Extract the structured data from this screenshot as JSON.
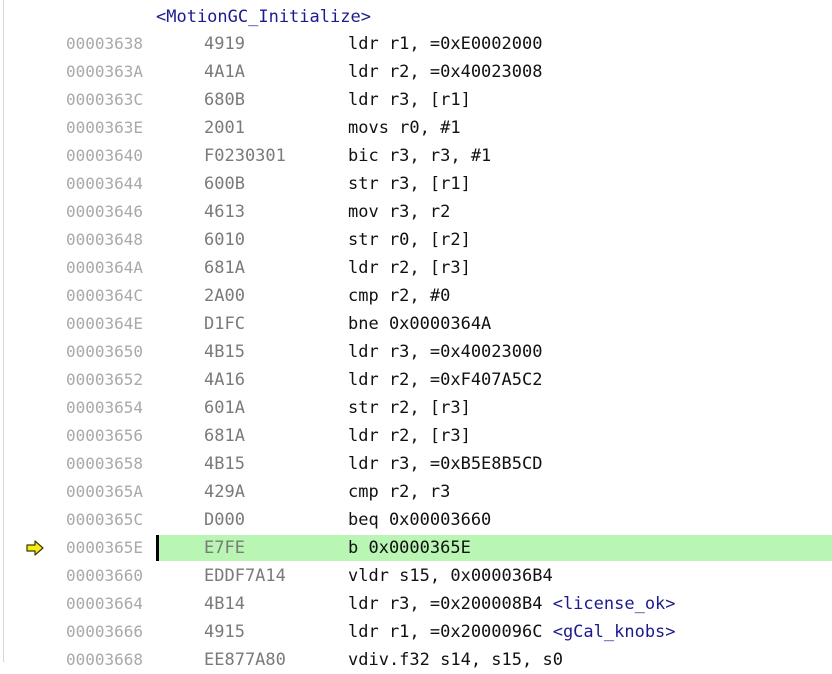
{
  "window": {
    "title": ""
  },
  "disassembly": {
    "symbol": "<MotionGC_Initialize>",
    "current_index": 18,
    "colors": {
      "current_line_bg": "#b9f5b3",
      "address": "#a9a9a9",
      "opcode": "#7a7a7a",
      "symbol": "#1b1b8f",
      "arrow": "#f5ea1a"
    },
    "pc_icon": "execution-arrow-icon",
    "rows": [
      {
        "addr": "00003638",
        "opcode": "4919",
        "instr": "ldr r1, =0xE0002000",
        "annot": ""
      },
      {
        "addr": "0000363A",
        "opcode": "4A1A",
        "instr": "ldr r2, =0x40023008",
        "annot": ""
      },
      {
        "addr": "0000363C",
        "opcode": "680B",
        "instr": "ldr r3, [r1]",
        "annot": ""
      },
      {
        "addr": "0000363E",
        "opcode": "2001",
        "instr": "movs r0, #1",
        "annot": ""
      },
      {
        "addr": "00003640",
        "opcode": "F0230301",
        "instr": "bic r3, r3, #1",
        "annot": ""
      },
      {
        "addr": "00003644",
        "opcode": "600B",
        "instr": "str r3, [r1]",
        "annot": ""
      },
      {
        "addr": "00003646",
        "opcode": "4613",
        "instr": "mov r3, r2",
        "annot": ""
      },
      {
        "addr": "00003648",
        "opcode": "6010",
        "instr": "str r0, [r2]",
        "annot": ""
      },
      {
        "addr": "0000364A",
        "opcode": "681A",
        "instr": "ldr r2, [r3]",
        "annot": ""
      },
      {
        "addr": "0000364C",
        "opcode": "2A00",
        "instr": "cmp r2, #0",
        "annot": ""
      },
      {
        "addr": "0000364E",
        "opcode": "D1FC",
        "instr": "bne 0x0000364A",
        "annot": ""
      },
      {
        "addr": "00003650",
        "opcode": "4B15",
        "instr": "ldr r3, =0x40023000",
        "annot": ""
      },
      {
        "addr": "00003652",
        "opcode": "4A16",
        "instr": "ldr r2, =0xF407A5C2",
        "annot": ""
      },
      {
        "addr": "00003654",
        "opcode": "601A",
        "instr": "str r2, [r3]",
        "annot": ""
      },
      {
        "addr": "00003656",
        "opcode": "681A",
        "instr": "ldr r2, [r3]",
        "annot": ""
      },
      {
        "addr": "00003658",
        "opcode": "4B15",
        "instr": "ldr r3, =0xB5E8B5CD",
        "annot": ""
      },
      {
        "addr": "0000365A",
        "opcode": "429A",
        "instr": "cmp r2, r3",
        "annot": ""
      },
      {
        "addr": "0000365C",
        "opcode": "D000",
        "instr": "beq 0x00003660",
        "annot": ""
      },
      {
        "addr": "0000365E",
        "opcode": "E7FE",
        "instr": "b 0x0000365E",
        "annot": ""
      },
      {
        "addr": "00003660",
        "opcode": "EDDF7A14",
        "instr": "vldr s15, 0x000036B4",
        "annot": ""
      },
      {
        "addr": "00003664",
        "opcode": "4B14",
        "instr": "ldr r3, =0x200008B4 ",
        "annot": "<license_ok>"
      },
      {
        "addr": "00003666",
        "opcode": "4915",
        "instr": "ldr r1, =0x2000096C ",
        "annot": "<gCal_knobs>"
      },
      {
        "addr": "00003668",
        "opcode": "EE877A80",
        "instr": "vdiv.f32 s14, s15, s0",
        "annot": ""
      }
    ]
  }
}
